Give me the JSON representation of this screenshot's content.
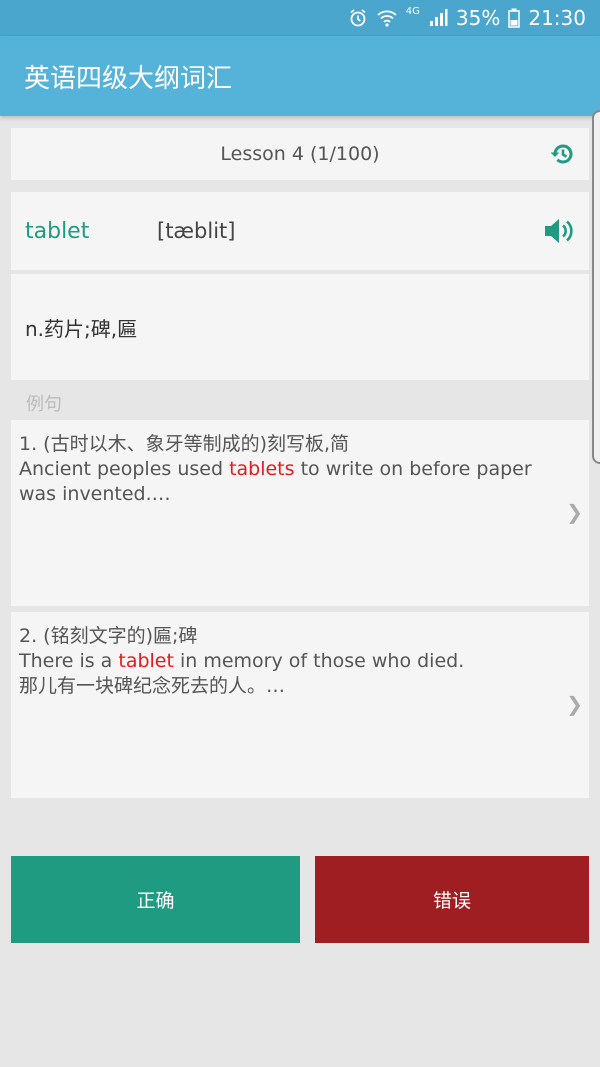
{
  "status_bar": {
    "network": "4G",
    "battery": "35%",
    "time": "21:30"
  },
  "app_bar": {
    "title": "英语四级大纲词汇"
  },
  "lesson": {
    "label": "Lesson 4  (1/100)"
  },
  "word": {
    "text": "tablet",
    "phonetic": "[tæblit]"
  },
  "meaning": {
    "text": "n.药片;碑,匾"
  },
  "examples_section": {
    "label": "例句"
  },
  "examples": [
    {
      "line1": "1. (古时以木、象牙等制成的)刻写板,简",
      "line2_before": "Ancient peoples used ",
      "line2_highlight": "tablets",
      "line2_after": " to write on before paper",
      "line3": "was invented.…"
    },
    {
      "line1": "2. (铭刻文字的)匾;碑",
      "line2_before": "There is a ",
      "line2_highlight": "tablet",
      "line2_after": " in memory of those who died.",
      "line3": "那儿有一块碑纪念死去的人。…"
    }
  ],
  "buttons": {
    "correct_label": "正确",
    "wrong_label": "错误"
  },
  "colors": {
    "app_bar": "#55b2d9",
    "accent_green": "#1e9b80",
    "wrong_red": "#9e1e22",
    "highlight": "#e31b1b"
  },
  "icons": {
    "history": "history-icon",
    "speaker": "speaker-icon",
    "chevron": "chevron-right-icon"
  }
}
